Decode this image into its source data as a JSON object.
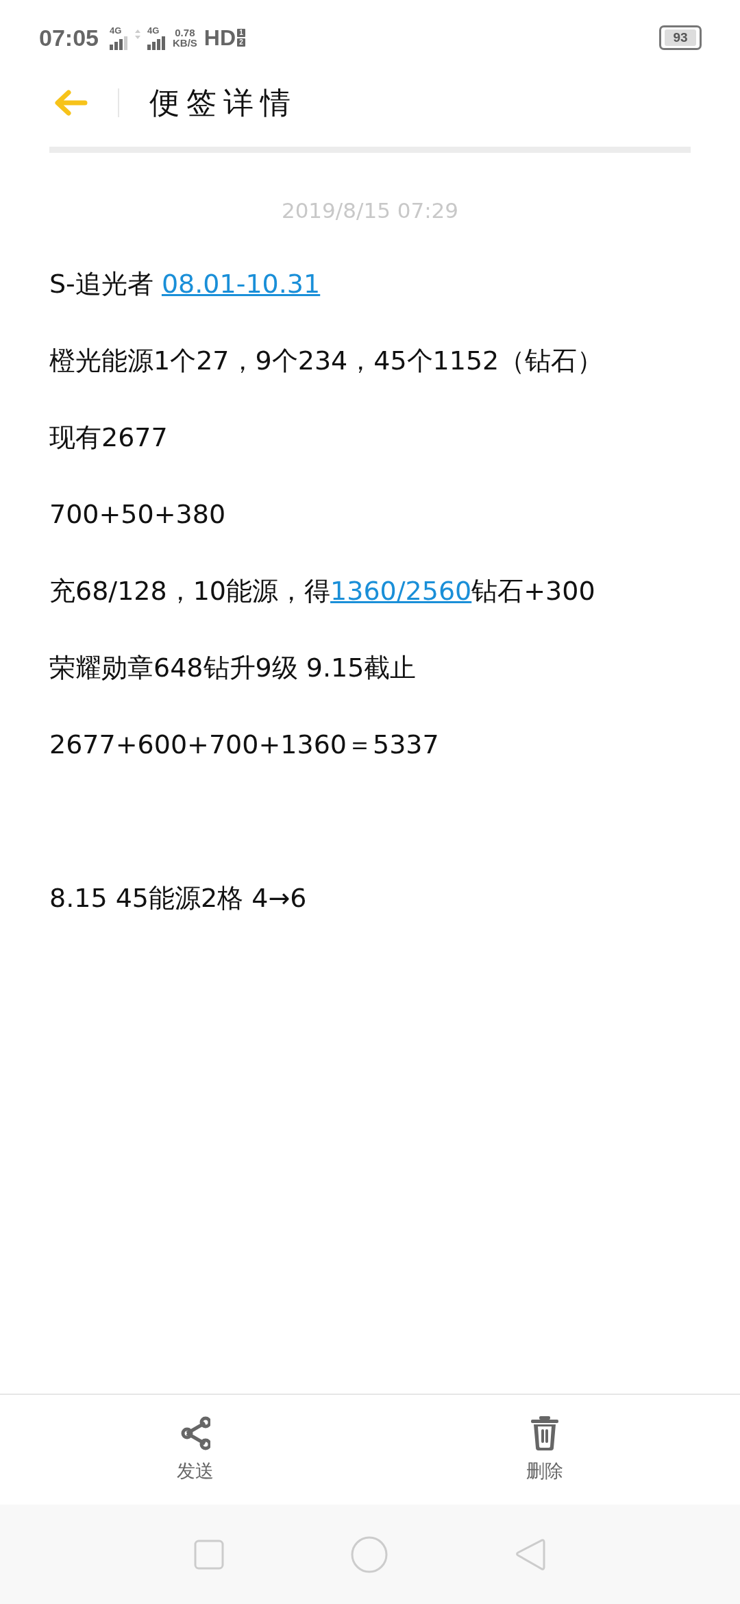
{
  "status_bar": {
    "time": "07:05",
    "sim1": {
      "network": "4G"
    },
    "sim2": {
      "network": "4G"
    },
    "speed": {
      "value": "0.78",
      "unit": "KB/S"
    },
    "hd": {
      "label": "HD",
      "slots": [
        "1",
        "2"
      ]
    },
    "battery": "93"
  },
  "header": {
    "title": "便签详情"
  },
  "note": {
    "date": "2019/8/15 07:29",
    "lines": [
      {
        "kind": "text",
        "segments": [
          {
            "kind": "text",
            "text": "S-追光者 "
          },
          {
            "kind": "link",
            "text": "08.01-10.31"
          }
        ]
      },
      {
        "kind": "text",
        "segments": [
          {
            "kind": "text",
            "text": "橙光能源1个27，9个234，45个1152（钻石）"
          }
        ]
      },
      {
        "kind": "text",
        "segments": [
          {
            "kind": "text",
            "text": "现有2677"
          }
        ]
      },
      {
        "kind": "text",
        "segments": [
          {
            "kind": "text",
            "text": "700+50+380"
          }
        ]
      },
      {
        "kind": "text",
        "segments": [
          {
            "kind": "text",
            "text": "充68/128，10能源，得"
          },
          {
            "kind": "link",
            "text": "1360/2560"
          },
          {
            "kind": "text",
            "text": "钻石+300"
          }
        ]
      },
      {
        "kind": "text",
        "segments": [
          {
            "kind": "text",
            "text": "荣耀勋章648钻升9级  9.15截止"
          }
        ]
      },
      {
        "kind": "text",
        "segments": [
          {
            "kind": "text",
            "text": "2677+600+700+1360＝5337"
          }
        ]
      },
      {
        "kind": "blank"
      },
      {
        "kind": "text",
        "segments": [
          {
            "kind": "text",
            "text": "8.15  45能源2格   4→6"
          }
        ]
      }
    ]
  },
  "actions": [
    {
      "kind": "share",
      "label": "发送"
    },
    {
      "kind": "delete",
      "label": "删除"
    }
  ],
  "nav_bar": [
    {
      "kind": "recent"
    },
    {
      "kind": "home"
    },
    {
      "kind": "back"
    }
  ]
}
